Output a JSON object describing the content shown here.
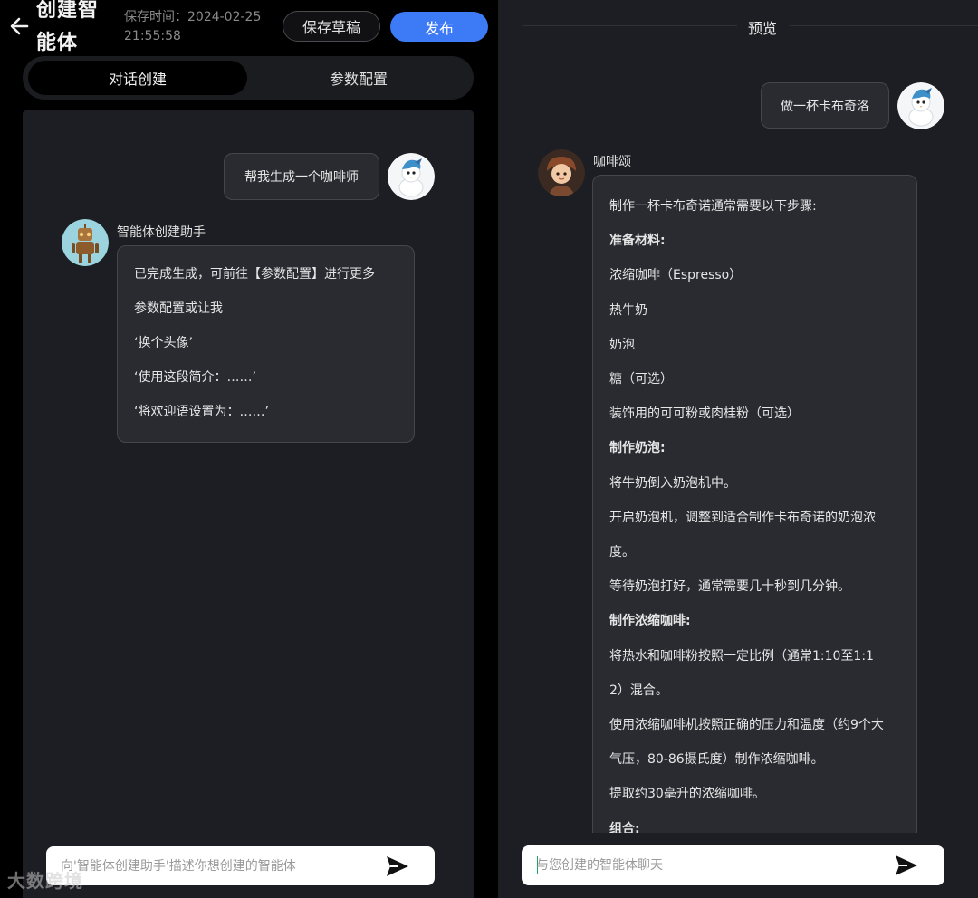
{
  "header": {
    "title": "创建智能体",
    "save_time_label": "保存时间：2024-02-25",
    "save_time_value": "21:55:58",
    "draft_label": "保存草稿",
    "publish_label": "发布"
  },
  "tabs": [
    {
      "label": "对话创建",
      "active": true
    },
    {
      "label": "参数配置",
      "active": false
    }
  ],
  "left_chat": {
    "user_message": "帮我生成一个咖啡师",
    "bot_name": "智能体创建助手",
    "bot_lines": [
      "已完成生成，可前往【参数配置】进行更多",
      "参数配置或让我",
      "‘换个头像’",
      "‘使用这段简介：……’",
      "‘将欢迎语设置为：……’"
    ],
    "input_placeholder": "向'智能体创建助手'描述你想创建的智能体"
  },
  "preview": {
    "title": "预览",
    "user_message": "做一杯卡布奇洛",
    "bot_name": "咖啡颂",
    "bot_lines": [
      {
        "text": "制作一杯卡布奇诺通常需要以下步骤:",
        "bold": false
      },
      {
        "text": "准备材料:",
        "bold": true
      },
      {
        "text": "浓缩咖啡（Espresso）",
        "bold": false
      },
      {
        "text": "热牛奶",
        "bold": false
      },
      {
        "text": "奶泡",
        "bold": false
      },
      {
        "text": "糖（可选）",
        "bold": false
      },
      {
        "text": "装饰用的可可粉或肉桂粉（可选）",
        "bold": false
      },
      {
        "text": "制作奶泡:",
        "bold": true
      },
      {
        "text": "将牛奶倒入奶泡机中。",
        "bold": false
      },
      {
        "text": "开启奶泡机，调整到适合制作卡布奇诺的奶泡浓",
        "bold": false
      },
      {
        "text": "度。",
        "bold": false
      },
      {
        "text": "等待奶泡打好，通常需要几十秒到几分钟。",
        "bold": false
      },
      {
        "text": "制作浓缩咖啡:",
        "bold": true
      },
      {
        "text": "将热水和咖啡粉按照一定比例（通常1:10至1:1",
        "bold": false
      },
      {
        "text": "2）混合。",
        "bold": false
      },
      {
        "text": "使用浓缩咖啡机按照正确的压力和温度（约9个大",
        "bold": false
      },
      {
        "text": "气压，80-86摄氏度）制作浓缩咖啡。",
        "bold": false
      },
      {
        "text": "提取约30毫升的浓缩咖啡。",
        "bold": false
      },
      {
        "text": "组合:",
        "bold": true
      }
    ],
    "input_placeholder": "与您创建的智能体聊天"
  },
  "watermark": "大数跨境",
  "colors": {
    "accent": "#3d7af5",
    "panel_bg": "#1d1e23",
    "bubble_bg": "#2a2b31"
  }
}
